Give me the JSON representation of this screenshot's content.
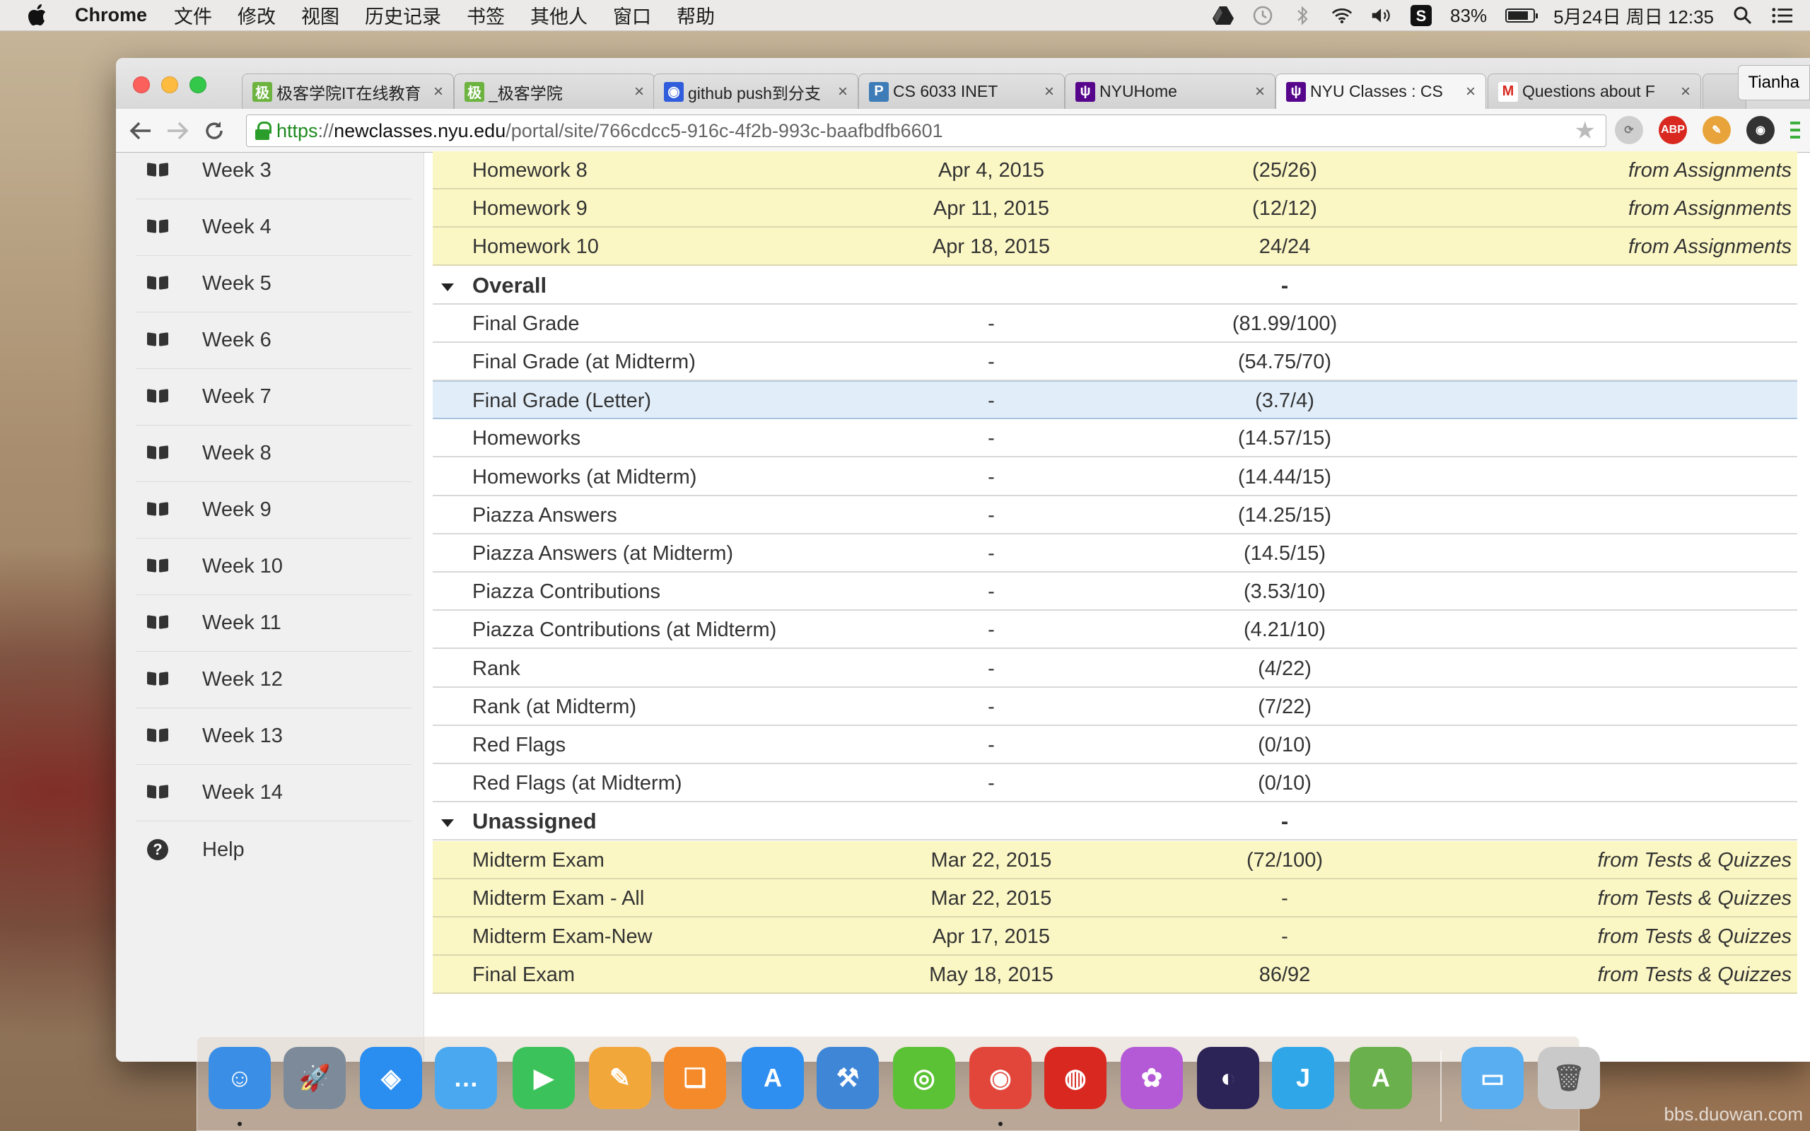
{
  "menubar": {
    "app_name": "Chrome",
    "menus": [
      "文件",
      "修改",
      "视图",
      "历史记录",
      "书签",
      "其他人",
      "窗口",
      "帮助"
    ],
    "battery_percent": "83%",
    "battery_level": 0.83,
    "datetime": "5月24日 周日  12:35"
  },
  "tabs": [
    {
      "title": "极客学院IT在线教育",
      "favicon": "geek-favicon",
      "color": "#6cb33f",
      "glyph": "极"
    },
    {
      "title": "_极客学院",
      "favicon": "geek-favicon",
      "color": "#6cb33f",
      "glyph": "极"
    },
    {
      "title": "github push到分支",
      "favicon": "baidu-paw-favicon",
      "color": "#2f5ddb",
      "glyph": "◉"
    },
    {
      "title": "CS 6033 INET",
      "favicon": "piazza-favicon",
      "color": "#3e7cb8",
      "glyph": "P"
    },
    {
      "title": "NYUHome",
      "favicon": "nyu-torch-favicon",
      "color": "#57068c",
      "glyph": "ψ"
    },
    {
      "title": "NYU Classes : CS",
      "favicon": "nyu-torch-favicon",
      "color": "#57068c",
      "glyph": "ψ"
    },
    {
      "title": "Questions about F",
      "favicon": "gmail-favicon",
      "color": "#ffffff",
      "glyph": "M"
    }
  ],
  "profile_name": "Tianha",
  "url": {
    "scheme": "https",
    "sep": "://",
    "host": "newclasses.nyu.edu",
    "path": "/portal/site/766cdcc5-916c-4f2b-993c-baafbdfb6601"
  },
  "extensions": [
    {
      "name": "sync-icon",
      "color": "#cfcfcf",
      "label": "⟳"
    },
    {
      "name": "adblock-plus-icon",
      "color": "#d8281f",
      "label": "ABP"
    },
    {
      "name": "color-wheel-icon",
      "color": "#e8a43a",
      "label": "✎"
    },
    {
      "name": "camera-lens-icon",
      "color": "#333333",
      "label": "◉"
    }
  ],
  "sidebar": {
    "items": [
      {
        "label": "Week 3"
      },
      {
        "label": "Week 4"
      },
      {
        "label": "Week 5"
      },
      {
        "label": "Week 6"
      },
      {
        "label": "Week 7"
      },
      {
        "label": "Week 8"
      },
      {
        "label": "Week 9"
      },
      {
        "label": "Week 10"
      },
      {
        "label": "Week 11"
      },
      {
        "label": "Week 12"
      },
      {
        "label": "Week 13"
      },
      {
        "label": "Week 14"
      }
    ],
    "help_label": "Help"
  },
  "gradebook": {
    "rows": [
      {
        "type": "assignment",
        "name": "Homework 8",
        "date": "Apr 4, 2015",
        "score": "(25/26)",
        "source": "from Assignments"
      },
      {
        "type": "assignment",
        "name": "Homework 9",
        "date": "Apr 11, 2015",
        "score": "(12/12)",
        "source": "from Assignments"
      },
      {
        "type": "assignment",
        "name": "Homework 10",
        "date": "Apr 18, 2015",
        "score": "24/24",
        "source": "from Assignments"
      },
      {
        "type": "category",
        "name": "Overall",
        "date": "",
        "score": "-",
        "source": ""
      },
      {
        "type": "item",
        "name": "Final Grade",
        "date": "-",
        "score": "(81.99/100)",
        "source": ""
      },
      {
        "type": "item",
        "name": "Final Grade (at Midterm)",
        "date": "-",
        "score": "(54.75/70)",
        "source": ""
      },
      {
        "type": "highlight",
        "name": "Final Grade (Letter)",
        "date": "-",
        "score": "(3.7/4)",
        "source": ""
      },
      {
        "type": "item",
        "name": "Homeworks",
        "date": "-",
        "score": "(14.57/15)",
        "source": ""
      },
      {
        "type": "item",
        "name": "Homeworks (at Midterm)",
        "date": "-",
        "score": "(14.44/15)",
        "source": ""
      },
      {
        "type": "item",
        "name": "Piazza Answers",
        "date": "-",
        "score": "(14.25/15)",
        "source": ""
      },
      {
        "type": "item",
        "name": "Piazza Answers (at Midterm)",
        "date": "-",
        "score": "(14.5/15)",
        "source": ""
      },
      {
        "type": "item",
        "name": "Piazza Contributions",
        "date": "-",
        "score": "(3.53/10)",
        "source": ""
      },
      {
        "type": "item",
        "name": "Piazza Contributions (at Midterm)",
        "date": "-",
        "score": "(4.21/10)",
        "source": ""
      },
      {
        "type": "item",
        "name": "Rank",
        "date": "-",
        "score": "(4/22)",
        "source": ""
      },
      {
        "type": "item",
        "name": "Rank (at Midterm)",
        "date": "-",
        "score": "(7/22)",
        "source": ""
      },
      {
        "type": "item",
        "name": "Red Flags",
        "date": "-",
        "score": "(0/10)",
        "source": ""
      },
      {
        "type": "item",
        "name": "Red Flags (at Midterm)",
        "date": "-",
        "score": "(0/10)",
        "source": ""
      },
      {
        "type": "category",
        "name": "Unassigned",
        "date": "",
        "score": "-",
        "source": ""
      },
      {
        "type": "assignment",
        "name": "Midterm Exam",
        "date": "Mar 22, 2015",
        "score": "(72/100)",
        "source": "from Tests & Quizzes"
      },
      {
        "type": "assignment",
        "name": "Midterm Exam - All",
        "date": "Mar 22, 2015",
        "score": "-",
        "source": "from Tests & Quizzes"
      },
      {
        "type": "assignment",
        "name": "Midterm Exam-New",
        "date": "Apr 17, 2015",
        "score": "-",
        "source": "from Tests & Quizzes"
      },
      {
        "type": "assignment",
        "name": "Final Exam",
        "date": "May 18, 2015",
        "score": "86/92",
        "source": "from Tests & Quizzes"
      }
    ]
  },
  "dock": [
    {
      "name": "finder-icon",
      "color": "#3a8ee6",
      "glyph": "☺",
      "running": true
    },
    {
      "name": "launchpad-icon",
      "color": "#7c8a99",
      "glyph": "🚀",
      "running": false
    },
    {
      "name": "safari-icon",
      "color": "#2a8df0",
      "glyph": "◈",
      "running": false
    },
    {
      "name": "messages-icon",
      "color": "#4aa8f0",
      "glyph": "…",
      "running": false
    },
    {
      "name": "facetime-icon",
      "color": "#3cc25a",
      "glyph": "▶",
      "running": false
    },
    {
      "name": "pages-icon",
      "color": "#f2a73b",
      "glyph": "✎",
      "running": false
    },
    {
      "name": "ibooks-icon",
      "color": "#f58a2b",
      "glyph": "❑",
      "running": false
    },
    {
      "name": "app-store-icon",
      "color": "#2e8ff0",
      "glyph": "A",
      "running": false
    },
    {
      "name": "xcode-icon",
      "color": "#3f86d6",
      "glyph": "⚒",
      "running": false
    },
    {
      "name": "wechat-icon",
      "color": "#5bc236",
      "glyph": "◎",
      "running": false
    },
    {
      "name": "chrome-icon",
      "color": "#e2463b",
      "glyph": "◉",
      "running": true
    },
    {
      "name": "netease-music-icon",
      "color": "#d8281f",
      "glyph": "◍",
      "running": false
    },
    {
      "name": "flower-app-icon",
      "color": "#b45ad6",
      "glyph": "✿",
      "running": false
    },
    {
      "name": "eclipse-icon",
      "color": "#2c2356",
      "glyph": "◐",
      "running": false
    },
    {
      "name": "intellij-icon",
      "color": "#2fa6e8",
      "glyph": "J",
      "running": false
    },
    {
      "name": "android-studio-icon",
      "color": "#6ab04c",
      "glyph": "A",
      "running": false
    },
    {
      "name": "folder-icon",
      "color": "#58aef0",
      "glyph": "▭",
      "running": false
    },
    {
      "name": "trash-icon",
      "color": "#c9c9c9",
      "glyph": "🗑",
      "running": false
    }
  ],
  "watermark": "bbs.duowan.com"
}
